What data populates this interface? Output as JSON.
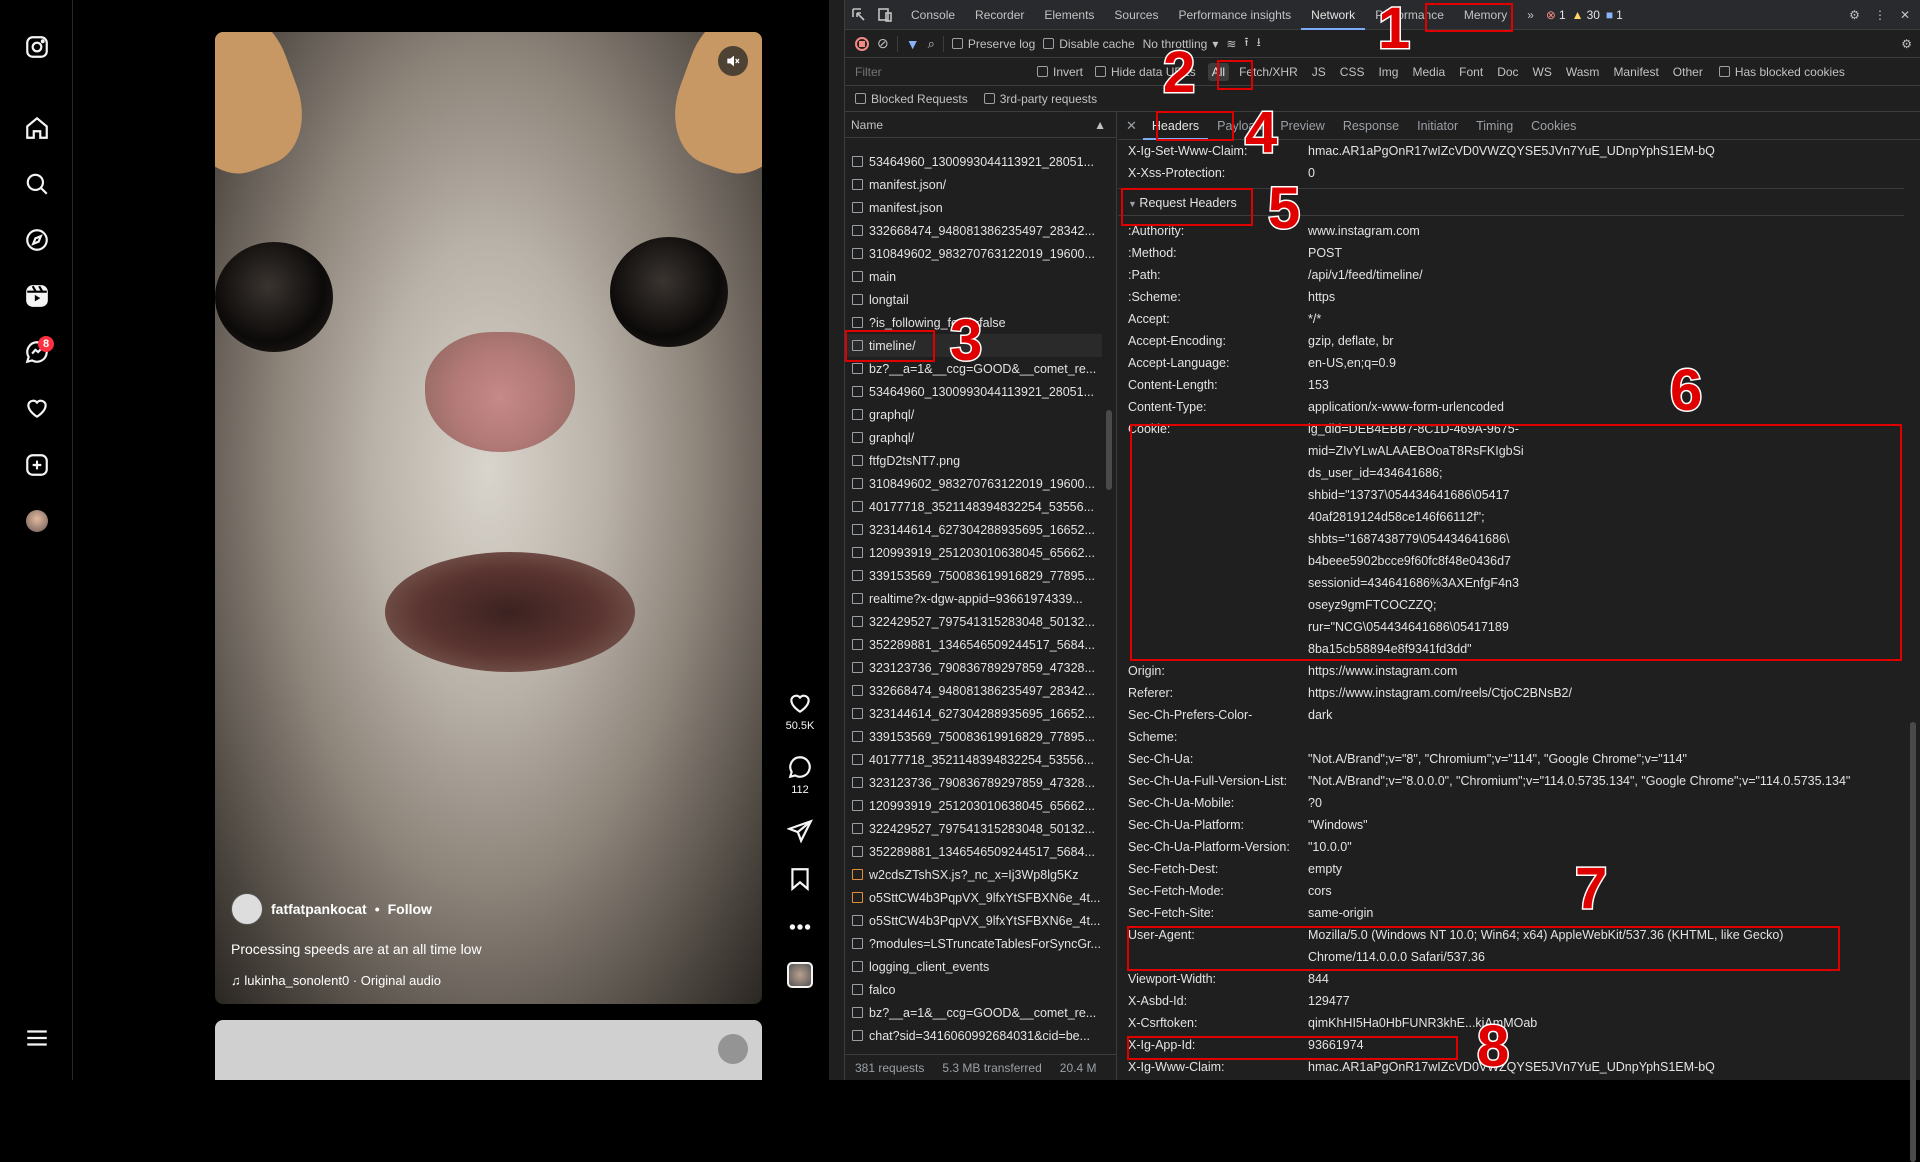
{
  "instagram": {
    "badge_count": "8",
    "reel": {
      "username": "fatfatpankocat",
      "follow_label": "Follow",
      "separator": "•",
      "caption": "Processing speeds are at an all time low",
      "audio": "lukinha_sonolent0 · Original audio",
      "likes": "50.5K",
      "comments": "112"
    },
    "nav_icons": [
      "instagram-logo-icon",
      "home-icon",
      "search-icon",
      "explore-icon",
      "reels-icon",
      "messages-icon",
      "notifications-heart-icon",
      "create-plus-icon",
      "profile-avatar",
      "menu-icon"
    ]
  },
  "devtools": {
    "tabs": [
      "Console",
      "Recorder",
      "Elements",
      "Sources",
      "Performance insights",
      "Network",
      "Performance",
      "Memory"
    ],
    "active_tab": "Network",
    "errors": "1",
    "warnings": "30",
    "messages": "1",
    "toolbar": {
      "preserve_log": "Preserve log",
      "disable_cache": "Disable cache",
      "throttling": "No throttling"
    },
    "filter": {
      "placeholder": "Filter",
      "invert": "Invert",
      "hide_data_urls": "Hide data URLs",
      "types": [
        "All",
        "Fetch/XHR",
        "JS",
        "CSS",
        "Img",
        "Media",
        "Font",
        "Doc",
        "WS",
        "Wasm",
        "Manifest",
        "Other"
      ],
      "has_blocked_cookies": "Has blocked cookies",
      "blocked_requests": "Blocked Requests",
      "third_party": "3rd-party requests"
    },
    "name_header": "Name",
    "requests": [
      "53464960_1300993044113921_28051...",
      "manifest.json/",
      "manifest.json",
      "332668474_948081386235497_28342...",
      "310849602_983270763122019_19600...",
      "main",
      "longtail",
      "?is_following_feed=false",
      "timeline/",
      "bz?__a=1&__ccg=GOOD&__comet_re...",
      "53464960_1300993044113921_28051...",
      "graphql/",
      "graphql/",
      "ftfgD2tsNT7.png",
      "310849602_983270763122019_19600...",
      "40177718_3521148394832254_53556...",
      "323144614_627304288935695_16652...",
      "120993919_251203010638045_65662...",
      "339153569_750083619916829_77895...",
      "realtime?x-dgw-appid=93661974339...",
      "322429527_797541315283048_50132...",
      "352289881_1346546509244517_5684...",
      "323123736_790836789297859_47328...",
      "332668474_948081386235497_28342...",
      "323144614_627304288935695_16652...",
      "339153569_750083619916829_77895...",
      "40177718_3521148394832254_53556...",
      "323123736_790836789297859_47328...",
      "120993919_251203010638045_65662...",
      "322429527_797541315283048_50132...",
      "352289881_1346546509244517_5684...",
      "w2cdsZTshSX.js?_nc_x=Ij3Wp8lg5Kz",
      "o5SttCW4b3PqpVX_9lfxYtSFBXN6e_4t...",
      "o5SttCW4b3PqpVX_9lfxYtSFBXN6e_4t...",
      "?modules=LSTruncateTablesForSyncGr...",
      "logging_client_events",
      "falco",
      "bz?__a=1&__ccg=GOOD&__comet_re...",
      "chat?sid=3416060992684031&cid=be..."
    ],
    "footer": {
      "requests": "381 requests",
      "transferred": "5.3 MB transferred",
      "resources": "20.4 M"
    },
    "detail_tabs": [
      "Headers",
      "Payload",
      "Preview",
      "Response",
      "Initiator",
      "Timing",
      "Cookies"
    ],
    "active_detail_tab": "Headers",
    "response_tail": [
      {
        "k": "X-Ig-Set-Www-Claim:",
        "v": "hmac.AR1aPgOnR17wIZcVD0VWZQYSE5JVn7YuE_UDnpYphS1EM-bQ"
      },
      {
        "k": "X-Xss-Protection:",
        "v": "0"
      }
    ],
    "section_title": "Request Headers",
    "request_headers": [
      {
        "k": ":Authority:",
        "v": "www.instagram.com"
      },
      {
        "k": ":Method:",
        "v": "POST"
      },
      {
        "k": ":Path:",
        "v": "/api/v1/feed/timeline/"
      },
      {
        "k": ":Scheme:",
        "v": "https"
      },
      {
        "k": "Accept:",
        "v": "*/*"
      },
      {
        "k": "Accept-Encoding:",
        "v": "gzip, deflate, br"
      },
      {
        "k": "Accept-Language:",
        "v": "en-US,en;q=0.9"
      },
      {
        "k": "Content-Length:",
        "v": "153"
      },
      {
        "k": "Content-Type:",
        "v": "application/x-www-form-urlencoded"
      }
    ],
    "cookie_key": "Cookie:",
    "cookie_lines": [
      "ig_did=DEB4EBB7-8C1D-469A-9675-",
      "mid=ZIvYLwALAAEBOoaT8RsFKIgbSi",
      "ds_user_id=434641686;",
      "shbid=\"13737\\054434641686\\05417",
      "40af2819124d58ce146f66112f\";",
      "shbts=\"1687438779\\054434641686\\",
      "b4beee5902bcce9f60fc8f48e0436d7",
      "sessionid=434641686%3AXEnfgF4n3",
      "oseyz9gmFTCOCZZQ;",
      "rur=\"NCG\\054434641686\\05417189",
      "8ba15cb58894e8f9341fd3dd\""
    ],
    "request_headers_2": [
      {
        "k": "Origin:",
        "v": "https://www.instagram.com"
      },
      {
        "k": "Referer:",
        "v": "https://www.instagram.com/reels/CtjoC2BNsB2/"
      },
      {
        "k": "Sec-Ch-Prefers-Color-",
        "v": "dark"
      },
      {
        "k": "Scheme:",
        "v": ""
      },
      {
        "k": "Sec-Ch-Ua:",
        "v": "\"Not.A/Brand\";v=\"8\", \"Chromium\";v=\"114\", \"Google Chrome\";v=\"114\""
      },
      {
        "k": "Sec-Ch-Ua-Full-Version-List:",
        "v": "\"Not.A/Brand\";v=\"8.0.0.0\", \"Chromium\";v=\"114.0.5735.134\", \"Google Chrome\";v=\"114.0.5735.134\""
      },
      {
        "k": "Sec-Ch-Ua-Mobile:",
        "v": "?0"
      },
      {
        "k": "Sec-Ch-Ua-Platform:",
        "v": "\"Windows\""
      },
      {
        "k": "Sec-Ch-Ua-Platform-Version:",
        "v": "\"10.0.0\""
      },
      {
        "k": "Sec-Fetch-Dest:",
        "v": "empty"
      },
      {
        "k": "Sec-Fetch-Mode:",
        "v": "cors"
      },
      {
        "k": "Sec-Fetch-Site:",
        "v": "same-origin"
      }
    ],
    "user_agent_key": "User-Agent:",
    "user_agent_lines": [
      "Mozilla/5.0 (Windows NT 10.0; Win64; x64) AppleWebKit/537.36 (KHTML, like Gecko)",
      "Chrome/114.0.0.0 Safari/537.36"
    ],
    "request_headers_3": [
      {
        "k": "Viewport-Width:",
        "v": "844"
      },
      {
        "k": "X-Asbd-Id:",
        "v": "129477"
      },
      {
        "k": "X-Csrftoken:",
        "v": "qimKhHI5Ha0HbFUNR3khE...kiAmMOab"
      },
      {
        "k": "X-Ig-App-Id:",
        "v": "93661974"
      },
      {
        "k": "X-Ig-Www-Claim:",
        "v": "hmac.AR1aPgOnR17wIZcVD0VWZQYSE5JVn7YuE_UDnpYphS1EM-bQ"
      }
    ]
  },
  "annotations": [
    "1",
    "2",
    "3",
    "4",
    "5",
    "6",
    "7",
    "8"
  ],
  "annotation_color": "#e00000"
}
